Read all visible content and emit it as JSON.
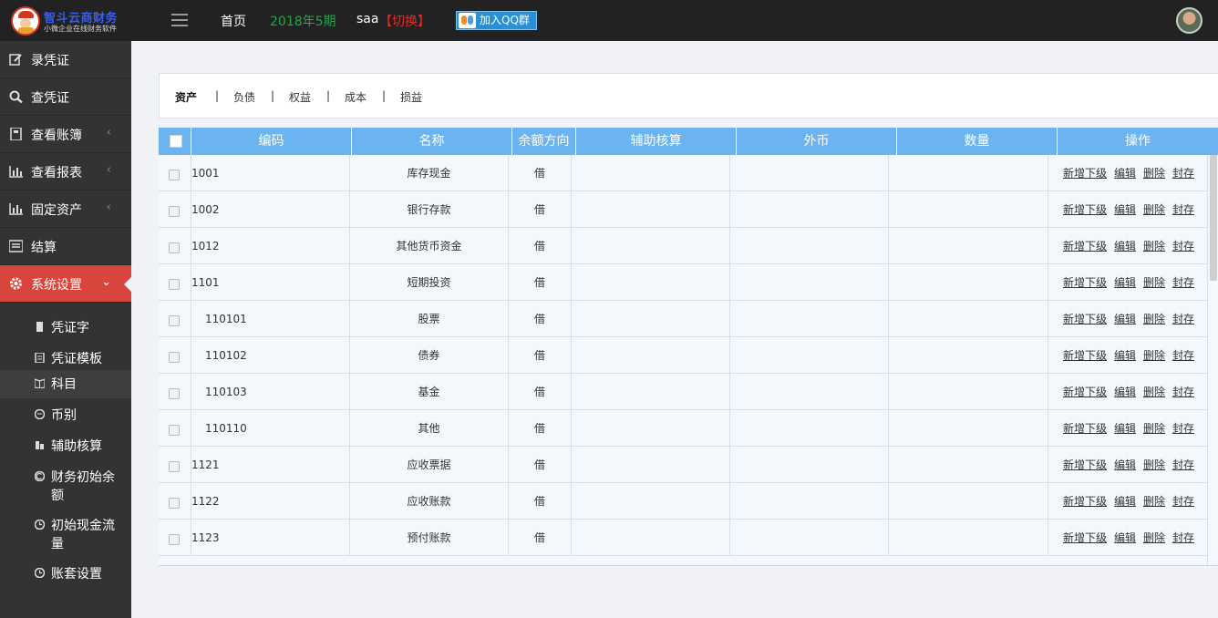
{
  "header": {
    "logo_title": "智斗云商财务",
    "logo_subtitle": "小微企业在线财务软件",
    "home": "首页",
    "period": "2018年5期",
    "user": "saa",
    "switch": "【切换】",
    "qq_button": "加入QQ群"
  },
  "sidebar": {
    "items": [
      {
        "label": "录凭证",
        "icon": "edit-icon",
        "chevron": ""
      },
      {
        "label": "查凭证",
        "icon": "search-icon",
        "chevron": ""
      },
      {
        "label": "查看账簿",
        "icon": "book-icon",
        "chevron": "‹"
      },
      {
        "label": "查看报表",
        "icon": "bar-chart-icon",
        "chevron": "‹"
      },
      {
        "label": "固定资产",
        "icon": "bar-chart-icon",
        "chevron": "‹"
      },
      {
        "label": "结算",
        "icon": "list-icon",
        "chevron": ""
      },
      {
        "label": "系统设置",
        "icon": "gear-icon",
        "chevron": "⌄"
      }
    ],
    "sub_items": [
      {
        "label": "凭证字",
        "icon": "file-icon"
      },
      {
        "label": "凭证模板",
        "icon": "template-icon"
      },
      {
        "label": "科目",
        "icon": "open-book-icon"
      },
      {
        "label": "币别",
        "icon": "currency-icon"
      },
      {
        "label": "辅助核算",
        "icon": "assist-icon"
      },
      {
        "label": "财务初始余额",
        "icon": "balance-icon"
      },
      {
        "label": "初始现金流量",
        "icon": "clock-icon"
      },
      {
        "label": "账套设置",
        "icon": "clock-icon"
      }
    ]
  },
  "tabs": [
    "资产",
    "负债",
    "权益",
    "成本",
    "损益"
  ],
  "tab_separator": "|",
  "table": {
    "columns": [
      "编码",
      "名称",
      "余额方向",
      "辅助核算",
      "外币",
      "数量",
      "操作"
    ],
    "operations": [
      "新增下级",
      "编辑",
      "删除",
      "封存"
    ],
    "rows": [
      {
        "code": "1001",
        "name": "库存现金",
        "dir": "借",
        "indent": false
      },
      {
        "code": "1002",
        "name": "银行存款",
        "dir": "借",
        "indent": false
      },
      {
        "code": "1012",
        "name": "其他货币资金",
        "dir": "借",
        "indent": false
      },
      {
        "code": "1101",
        "name": "短期投资",
        "dir": "借",
        "indent": false
      },
      {
        "code": "110101",
        "name": "股票",
        "dir": "借",
        "indent": true
      },
      {
        "code": "110102",
        "name": "债券",
        "dir": "借",
        "indent": true
      },
      {
        "code": "110103",
        "name": "基金",
        "dir": "借",
        "indent": true
      },
      {
        "code": "110110",
        "name": "其他",
        "dir": "借",
        "indent": true
      },
      {
        "code": "1121",
        "name": "应收票据",
        "dir": "借",
        "indent": false
      },
      {
        "code": "1122",
        "name": "应收账款",
        "dir": "借",
        "indent": false
      },
      {
        "code": "1123",
        "name": "预付账款",
        "dir": "借",
        "indent": false
      }
    ]
  },
  "colors": {
    "topbar": "#222222",
    "sidebar": "#333333",
    "active_menu": "#d9453d",
    "table_header": "#6cb4f0",
    "period_text": "#27a54a",
    "switch_text": "#e22b2b"
  }
}
